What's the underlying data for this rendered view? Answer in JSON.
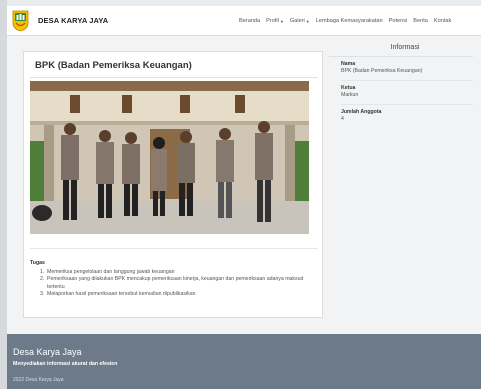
{
  "navbar": {
    "brand": "DESA KARYA JAYA",
    "items": [
      {
        "label": "Beranda",
        "dropdown": false
      },
      {
        "label": "Profil",
        "dropdown": true
      },
      {
        "label": "Galeri",
        "dropdown": true
      },
      {
        "label": "Lembaga Kemasyarakatan",
        "dropdown": false
      },
      {
        "label": "Potensi",
        "dropdown": false
      },
      {
        "label": "Berita",
        "dropdown": false
      },
      {
        "label": "Kontak",
        "dropdown": false
      }
    ]
  },
  "main": {
    "title": "BPK (Badan Pemeriksa Keuangan)",
    "tugas_label": "Tugas",
    "tugas": [
      {
        "num": "1.",
        "text": "Memeriksa pengelolaan dan tanggung jawab keuangan"
      },
      {
        "num": "2.",
        "text": "Pemeriksaan yang dilakukan BPK mencakup pemeriksaan kinerja, keuangan dan pemeriksaan adanya maksud tertentu"
      },
      {
        "num": "3.",
        "text": "Melaporkan hasil pemeriksaan tersebut kemudian dipublikasikan"
      }
    ]
  },
  "info": {
    "title": "Informasi",
    "fields": [
      {
        "label": "Nama",
        "value": "BPK (Badan Pemeriksa Keuangan)"
      },
      {
        "label": "Ketua",
        "value": "Markun"
      },
      {
        "label": "Jumlah Anggota",
        "value": "4"
      }
    ]
  },
  "footer": {
    "title": "Desa Karya Jaya",
    "tagline": "Menyediakan informasi akurat dan efesien",
    "copyright": "2022 Desa Karya Jaya"
  },
  "colors": {
    "footer_bg": "#6c7a89",
    "page_bg": "#e9ecef",
    "logo_yellow": "#f2c200",
    "logo_green": "#2e8b3a"
  },
  "icons": {
    "logo": "village-emblem-icon",
    "caret": "caret-down-icon"
  }
}
